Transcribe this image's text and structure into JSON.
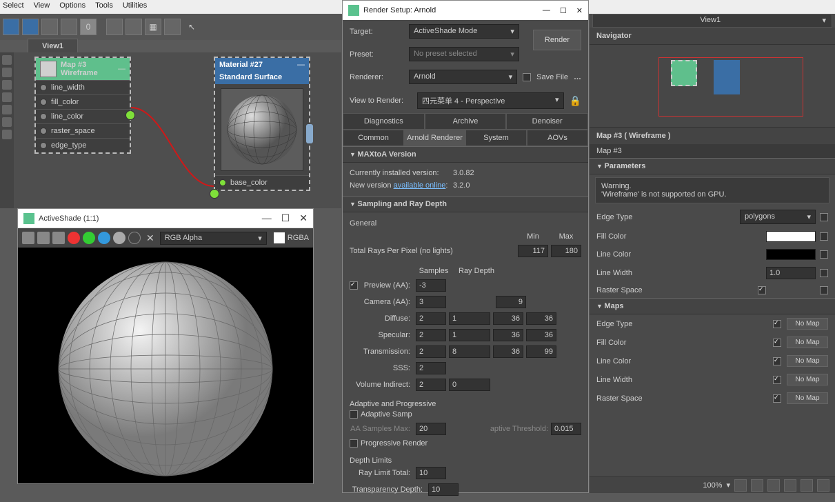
{
  "menubar": [
    "Select",
    "View",
    "Options",
    "Tools",
    "Utilities"
  ],
  "nodeview": {
    "tab": "View1",
    "node1": {
      "title1": "Map #3",
      "title2": "Wireframe",
      "rows": [
        "line_width",
        "fill_color",
        "line_color",
        "raster_space",
        "edge_type"
      ]
    },
    "node2": {
      "title1": "Material #27",
      "title2": "Standard Surface",
      "input": "base_color"
    }
  },
  "activeShade": {
    "title": "ActiveShade (1:1)",
    "channel": "RGB Alpha",
    "mode": "RGBA"
  },
  "renderSetup": {
    "title": "Render Setup: Arnold",
    "target_lab": "Target:",
    "target_val": "ActiveShade Mode",
    "preset_lab": "Preset:",
    "preset_val": "No preset selected",
    "renderer_lab": "Renderer:",
    "renderer_val": "Arnold",
    "view_lab": "View to Render:",
    "view_val": "四元菜单 4 - Perspective",
    "savefile": "Save File",
    "renderBtn": "Render",
    "tabs_top": [
      "Diagnostics",
      "Archive",
      "Denoiser"
    ],
    "tabs_bot": [
      "Common",
      "Arnold Renderer",
      "System",
      "AOVs"
    ],
    "rolls": {
      "ver_head": "MAXtoA Version",
      "ver_cur_lab": "Currently installed version:",
      "ver_cur": "3.0.82",
      "ver_new_lab": "New version ",
      "ver_new_link": "available online",
      "ver_new_suffix": ":",
      "ver_new": "3.2.0",
      "samp_head": "Sampling and Ray Depth",
      "general": "General",
      "samplescol": "Samples",
      "raydepthcol": "Ray Depth",
      "mincol": "Min",
      "maxcol": "Max",
      "trpp_lab": "Total Rays Per Pixel (no lights)",
      "trpp_min": "117",
      "trpp_max": "180",
      "preview_lab": "Preview (AA):",
      "preview": "-3",
      "camera_lab": "Camera (AA):",
      "camera_s": "3",
      "camera_m": "9",
      "diffuse_lab": "Diffuse:",
      "diffuse_s": "2",
      "diffuse_d": "1",
      "diffuse_min": "36",
      "diffuse_max": "36",
      "spec_lab": "Specular:",
      "spec_s": "2",
      "spec_d": "1",
      "spec_min": "36",
      "spec_max": "36",
      "trans_lab": "Transmission:",
      "trans_s": "2",
      "trans_d": "8",
      "trans_min": "36",
      "trans_max": "99",
      "sss_lab": "SSS:",
      "sss_s": "2",
      "vol_lab": "Volume Indirect:",
      "vol_s": "2",
      "vol_d": "0",
      "adaptive": "Adaptive and Progressive",
      "adaptive_chk": "Adaptive Samp",
      "aasamp_lab": "AA Samples Max:",
      "aasamp": "20",
      "athresh_lab": "aptive Threshold:",
      "athresh": "0.015",
      "prog": "Progressive Render",
      "depthlim": "Depth Limits",
      "raylim_lab": "Ray Limit Total:",
      "raylim": "10",
      "transdepth_lab": "Transparency Depth:",
      "transdepth": "10"
    }
  },
  "rightPanel": {
    "viewdd": "View1",
    "nav": "Navigator",
    "insp_title": "Map #3  ( Wireframe )",
    "obj": "Map #3",
    "params": "Parameters",
    "warn1": "Warning.",
    "warn2": "'Wireframe' is not supported on GPU.",
    "edge_lab": "Edge Type",
    "edge_val": "polygons",
    "fill_lab": "Fill Color",
    "line_lab": "Line Color",
    "lw_lab": "Line Width",
    "lw_val": "1.0",
    "rs_lab": "Raster Space",
    "maps_head": "Maps",
    "maps": [
      "Edge Type",
      "Fill Color",
      "Line Color",
      "Line Width",
      "Raster Space"
    ],
    "nomap": "No Map"
  },
  "status": {
    "zoom": "100%"
  }
}
